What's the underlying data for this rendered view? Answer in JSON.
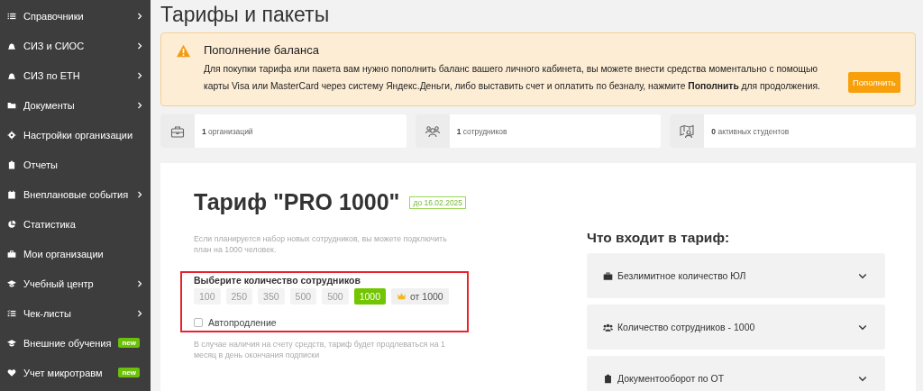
{
  "sidebar": {
    "items": [
      {
        "label": "Справочники",
        "submenu": true
      },
      {
        "label": "СИЗ и СИОС",
        "submenu": true
      },
      {
        "label": "СИЗ по ЕТН",
        "submenu": true
      },
      {
        "label": "Документы",
        "submenu": true
      },
      {
        "label": "Настройки организации",
        "submenu": false
      },
      {
        "label": "Отчеты",
        "submenu": false
      },
      {
        "label": "Внеплановые события",
        "submenu": true
      },
      {
        "label": "Статистика",
        "submenu": false
      },
      {
        "label": "Мои организации",
        "submenu": false
      },
      {
        "label": "Учебный центр",
        "submenu": true
      },
      {
        "label": "Чек-листы",
        "submenu": true
      },
      {
        "label": "Внешние обучения",
        "submenu": false,
        "badge": "new"
      },
      {
        "label": "Учет микротравм",
        "submenu": false,
        "badge": "new"
      }
    ]
  },
  "page_title": "Тарифы и пакеты",
  "alert": {
    "title": "Пополнение баланса",
    "text": "Для покупки тарифа или пакета вам нужно пополнить баланс вашего личного кабинета, вы можете внести средства моментально с помощью карты Visa или MasterCard через систему Яндекс.Деньги, либо выставить счет и оплатить по безналу, нажмите **Пополнить** для продолжения.",
    "button": "Пополнить"
  },
  "stats": [
    {
      "count": "1",
      "label": "организаций"
    },
    {
      "count": "1",
      "label": "сотрудников"
    },
    {
      "count": "0",
      "label": "активных студентов"
    }
  ],
  "tariff": {
    "title": "Тариф \"PRO 1000\"",
    "valid_until": "до 16.02.2025",
    "description": "Если планируется набор новых сотрудников, вы можете подключить план на 1000 человек.",
    "selector": {
      "label": "Выберите количество сотрудников",
      "options": [
        {
          "label": "100",
          "kind": "size",
          "selected": false,
          "disabled": true
        },
        {
          "label": "250",
          "kind": "size",
          "selected": false,
          "disabled": true
        },
        {
          "label": "350",
          "kind": "size",
          "selected": false,
          "disabled": true
        },
        {
          "label": "500",
          "kind": "size",
          "selected": false,
          "disabled": true
        },
        {
          "label": "500",
          "kind": "size",
          "selected": false,
          "disabled": true
        },
        {
          "label": "1000",
          "kind": "size",
          "selected": true,
          "disabled": false
        },
        {
          "label": "от 1000",
          "kind": "premium",
          "selected": false,
          "disabled": false
        }
      ],
      "autorenew": {
        "label": "Автопродление",
        "checked": false
      }
    },
    "note": "В случае наличия на счету средств, тариф будет продлеваться на 1 месяц в день окончания подписки"
  },
  "includes": {
    "title": "Что входит в тариф:",
    "items": [
      {
        "label": "Безлимитное количество ЮЛ",
        "expanded": false
      },
      {
        "label": "Количество сотрудников - 1000",
        "expanded": false
      },
      {
        "label": "Документооборот по ОТ",
        "expanded": false
      }
    ]
  }
}
